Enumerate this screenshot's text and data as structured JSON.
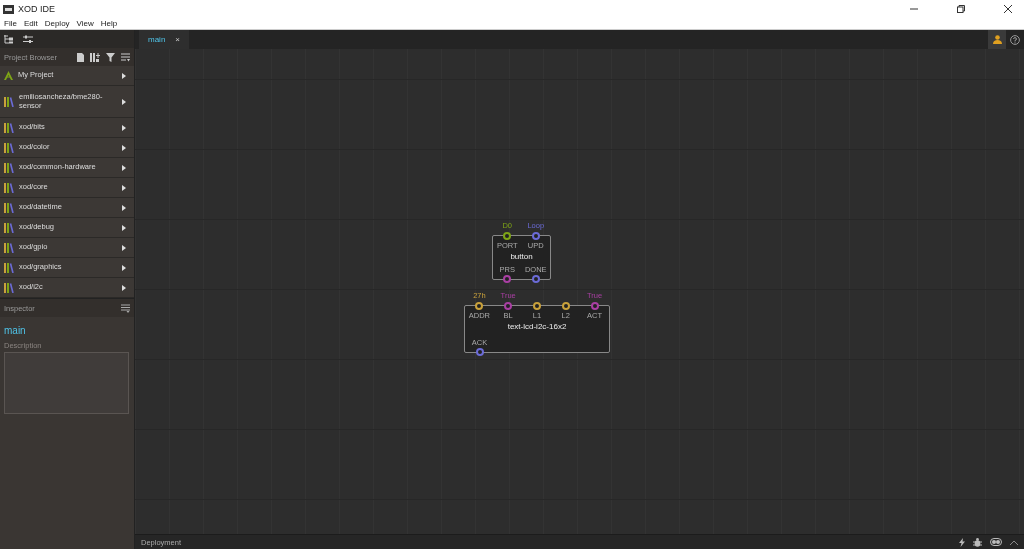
{
  "window": {
    "title": "XOD IDE"
  },
  "menu": [
    "File",
    "Edit",
    "Deploy",
    "View",
    "Help"
  ],
  "project_browser": {
    "title": "Project Browser",
    "items": [
      {
        "label": "My Project",
        "kind": "project"
      },
      {
        "label": "emiliosancheza/bme280-sensor",
        "kind": "library"
      },
      {
        "label": "xod/bits",
        "kind": "library"
      },
      {
        "label": "xod/color",
        "kind": "library"
      },
      {
        "label": "xod/common-hardware",
        "kind": "library"
      },
      {
        "label": "xod/core",
        "kind": "library"
      },
      {
        "label": "xod/datetime",
        "kind": "library"
      },
      {
        "label": "xod/debug",
        "kind": "library"
      },
      {
        "label": "xod/gpio",
        "kind": "library"
      },
      {
        "label": "xod/graphics",
        "kind": "library"
      },
      {
        "label": "xod/i2c",
        "kind": "library"
      }
    ]
  },
  "inspector": {
    "title": "Inspector",
    "patch_name": "main",
    "description_label": "Description"
  },
  "tabs": [
    {
      "label": "main",
      "close": "×",
      "selected": true
    }
  ],
  "nodes": [
    {
      "title": "button",
      "inputs": [
        {
          "label": "PORT",
          "value": "D0",
          "color": "#7ea516"
        },
        {
          "label": "UPD",
          "value": "Loop",
          "color": "#6b6bd6"
        }
      ],
      "outputs": [
        {
          "label": "PRS",
          "color": "#a93fa3"
        },
        {
          "label": "DONE",
          "color": "#6b6bd6"
        }
      ]
    },
    {
      "title": "text-lcd-i2c-16x2",
      "inputs": [
        {
          "label": "ADDR",
          "value": "27h",
          "color": "#c9a13b"
        },
        {
          "label": "BL",
          "value": "True",
          "color": "#a93fa3"
        },
        {
          "label": "L1",
          "color": "#c9a13b"
        },
        {
          "label": "L2",
          "color": "#c9a13b"
        },
        {
          "label": "ACT",
          "value": "True",
          "color": "#a93fa3"
        }
      ],
      "outputs": [
        {
          "label": "ACK",
          "color": "#6b6bd6"
        }
      ]
    }
  ],
  "status_bar": {
    "title": "Deployment"
  }
}
